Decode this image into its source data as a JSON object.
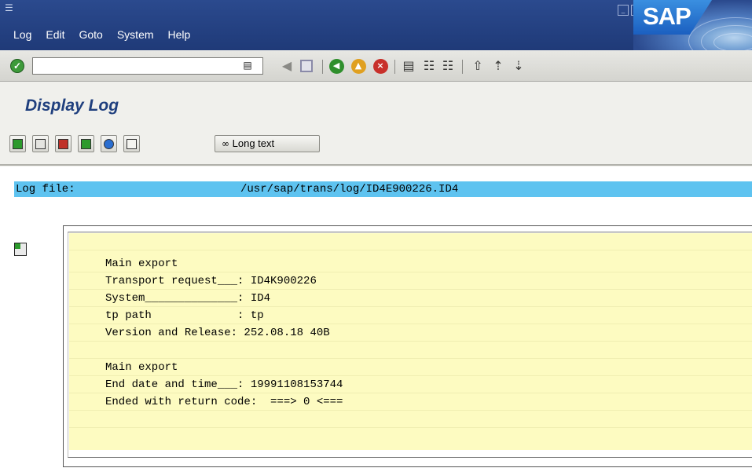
{
  "window": {
    "menu": [
      {
        "label": "Log"
      },
      {
        "label": "Edit"
      },
      {
        "label": "Goto"
      },
      {
        "label": "System"
      },
      {
        "label": "Help"
      }
    ],
    "logo_text": "SAP"
  },
  "toolbar": {
    "command_field_value": ""
  },
  "screen": {
    "title": "Display Log"
  },
  "app_toolbar": {
    "long_text_label": "Long text"
  },
  "log": {
    "file_label": "Log file:",
    "file_path": "/usr/sap/trans/log/ID4E900226.ID4",
    "lines": [
      "",
      "Main export",
      "Transport request___: ID4K900226",
      "System______________: ID4",
      "tp path             : tp",
      "Version and Release: 252.08.18 40B",
      "",
      "Main export",
      "End date and time___: 19991108153744",
      "Ended with return code:  ===> 0 <===",
      ""
    ]
  },
  "colors": {
    "title_bar": "#1f3a78",
    "log_header_bg": "#5ec3f0",
    "log_body_bg": "#fdfbc1",
    "screen_title": "#1f3f7e"
  }
}
